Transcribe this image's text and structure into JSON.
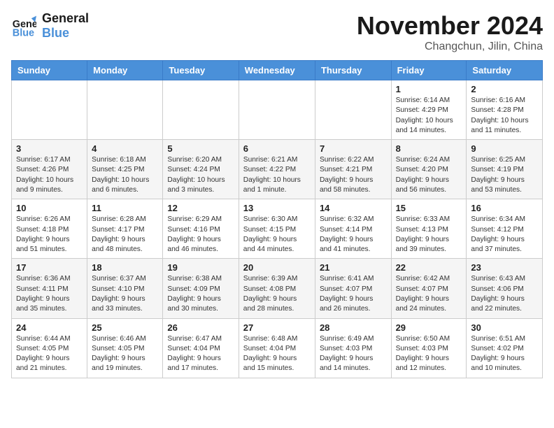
{
  "header": {
    "logo_line1": "General",
    "logo_line2": "Blue",
    "month": "November 2024",
    "location": "Changchun, Jilin, China"
  },
  "days_of_week": [
    "Sunday",
    "Monday",
    "Tuesday",
    "Wednesday",
    "Thursday",
    "Friday",
    "Saturday"
  ],
  "weeks": [
    [
      {
        "day": "",
        "info": ""
      },
      {
        "day": "",
        "info": ""
      },
      {
        "day": "",
        "info": ""
      },
      {
        "day": "",
        "info": ""
      },
      {
        "day": "",
        "info": ""
      },
      {
        "day": "1",
        "info": "Sunrise: 6:14 AM\nSunset: 4:29 PM\nDaylight: 10 hours and 14 minutes."
      },
      {
        "day": "2",
        "info": "Sunrise: 6:16 AM\nSunset: 4:28 PM\nDaylight: 10 hours and 11 minutes."
      }
    ],
    [
      {
        "day": "3",
        "info": "Sunrise: 6:17 AM\nSunset: 4:26 PM\nDaylight: 10 hours and 9 minutes."
      },
      {
        "day": "4",
        "info": "Sunrise: 6:18 AM\nSunset: 4:25 PM\nDaylight: 10 hours and 6 minutes."
      },
      {
        "day": "5",
        "info": "Sunrise: 6:20 AM\nSunset: 4:24 PM\nDaylight: 10 hours and 3 minutes."
      },
      {
        "day": "6",
        "info": "Sunrise: 6:21 AM\nSunset: 4:22 PM\nDaylight: 10 hours and 1 minute."
      },
      {
        "day": "7",
        "info": "Sunrise: 6:22 AM\nSunset: 4:21 PM\nDaylight: 9 hours and 58 minutes."
      },
      {
        "day": "8",
        "info": "Sunrise: 6:24 AM\nSunset: 4:20 PM\nDaylight: 9 hours and 56 minutes."
      },
      {
        "day": "9",
        "info": "Sunrise: 6:25 AM\nSunset: 4:19 PM\nDaylight: 9 hours and 53 minutes."
      }
    ],
    [
      {
        "day": "10",
        "info": "Sunrise: 6:26 AM\nSunset: 4:18 PM\nDaylight: 9 hours and 51 minutes."
      },
      {
        "day": "11",
        "info": "Sunrise: 6:28 AM\nSunset: 4:17 PM\nDaylight: 9 hours and 48 minutes."
      },
      {
        "day": "12",
        "info": "Sunrise: 6:29 AM\nSunset: 4:16 PM\nDaylight: 9 hours and 46 minutes."
      },
      {
        "day": "13",
        "info": "Sunrise: 6:30 AM\nSunset: 4:15 PM\nDaylight: 9 hours and 44 minutes."
      },
      {
        "day": "14",
        "info": "Sunrise: 6:32 AM\nSunset: 4:14 PM\nDaylight: 9 hours and 41 minutes."
      },
      {
        "day": "15",
        "info": "Sunrise: 6:33 AM\nSunset: 4:13 PM\nDaylight: 9 hours and 39 minutes."
      },
      {
        "day": "16",
        "info": "Sunrise: 6:34 AM\nSunset: 4:12 PM\nDaylight: 9 hours and 37 minutes."
      }
    ],
    [
      {
        "day": "17",
        "info": "Sunrise: 6:36 AM\nSunset: 4:11 PM\nDaylight: 9 hours and 35 minutes."
      },
      {
        "day": "18",
        "info": "Sunrise: 6:37 AM\nSunset: 4:10 PM\nDaylight: 9 hours and 33 minutes."
      },
      {
        "day": "19",
        "info": "Sunrise: 6:38 AM\nSunset: 4:09 PM\nDaylight: 9 hours and 30 minutes."
      },
      {
        "day": "20",
        "info": "Sunrise: 6:39 AM\nSunset: 4:08 PM\nDaylight: 9 hours and 28 minutes."
      },
      {
        "day": "21",
        "info": "Sunrise: 6:41 AM\nSunset: 4:07 PM\nDaylight: 9 hours and 26 minutes."
      },
      {
        "day": "22",
        "info": "Sunrise: 6:42 AM\nSunset: 4:07 PM\nDaylight: 9 hours and 24 minutes."
      },
      {
        "day": "23",
        "info": "Sunrise: 6:43 AM\nSunset: 4:06 PM\nDaylight: 9 hours and 22 minutes."
      }
    ],
    [
      {
        "day": "24",
        "info": "Sunrise: 6:44 AM\nSunset: 4:05 PM\nDaylight: 9 hours and 21 minutes."
      },
      {
        "day": "25",
        "info": "Sunrise: 6:46 AM\nSunset: 4:05 PM\nDaylight: 9 hours and 19 minutes."
      },
      {
        "day": "26",
        "info": "Sunrise: 6:47 AM\nSunset: 4:04 PM\nDaylight: 9 hours and 17 minutes."
      },
      {
        "day": "27",
        "info": "Sunrise: 6:48 AM\nSunset: 4:04 PM\nDaylight: 9 hours and 15 minutes."
      },
      {
        "day": "28",
        "info": "Sunrise: 6:49 AM\nSunset: 4:03 PM\nDaylight: 9 hours and 14 minutes."
      },
      {
        "day": "29",
        "info": "Sunrise: 6:50 AM\nSunset: 4:03 PM\nDaylight: 9 hours and 12 minutes."
      },
      {
        "day": "30",
        "info": "Sunrise: 6:51 AM\nSunset: 4:02 PM\nDaylight: 9 hours and 10 minutes."
      }
    ]
  ]
}
